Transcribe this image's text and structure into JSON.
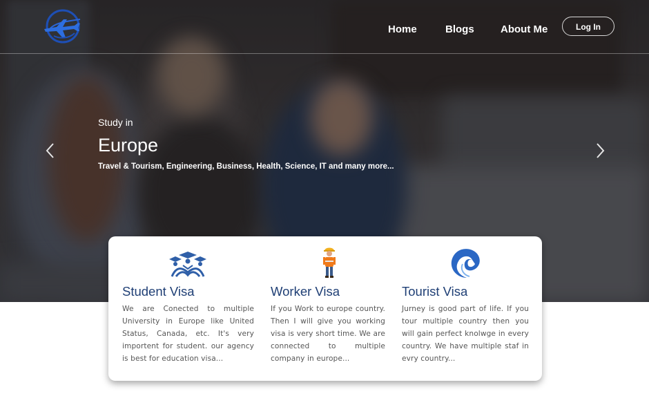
{
  "header": {
    "logo_icon": "airplane-globe-icon",
    "nav": [
      {
        "label": "Home"
      },
      {
        "label": "Blogs"
      },
      {
        "label": "About Me"
      }
    ],
    "login_label": "Log In"
  },
  "hero": {
    "subtitle": "Study in",
    "title": "Europe",
    "description": "Travel & Tourism, Engineering, Business, Health, Science, IT and many more...",
    "prev_icon": "chevron-left-icon",
    "next_icon": "chevron-right-icon"
  },
  "services": [
    {
      "icon": "graduation-cap-icon",
      "title": "Student Visa",
      "text": "We are Conected to multiple University in Europe like United Status, Canada, etc. It's very importent for student. our agency is best for education visa..."
    },
    {
      "icon": "construction-worker-icon",
      "title": "Worker Visa",
      "text": "If you Work to europe country. Then I will give you working visa is very short time. We are connected to multiple company in europe..."
    },
    {
      "icon": "wave-icon",
      "title": "Tourist Visa",
      "text": "Jurney is good part of life. If you tour multiple country then you will gain perfect knolwge in every country. We have multiple staf in evry country..."
    }
  ],
  "colors": {
    "title_blue": "#1f3f75",
    "body_text": "#555555",
    "card_bg": "#ffffff"
  }
}
